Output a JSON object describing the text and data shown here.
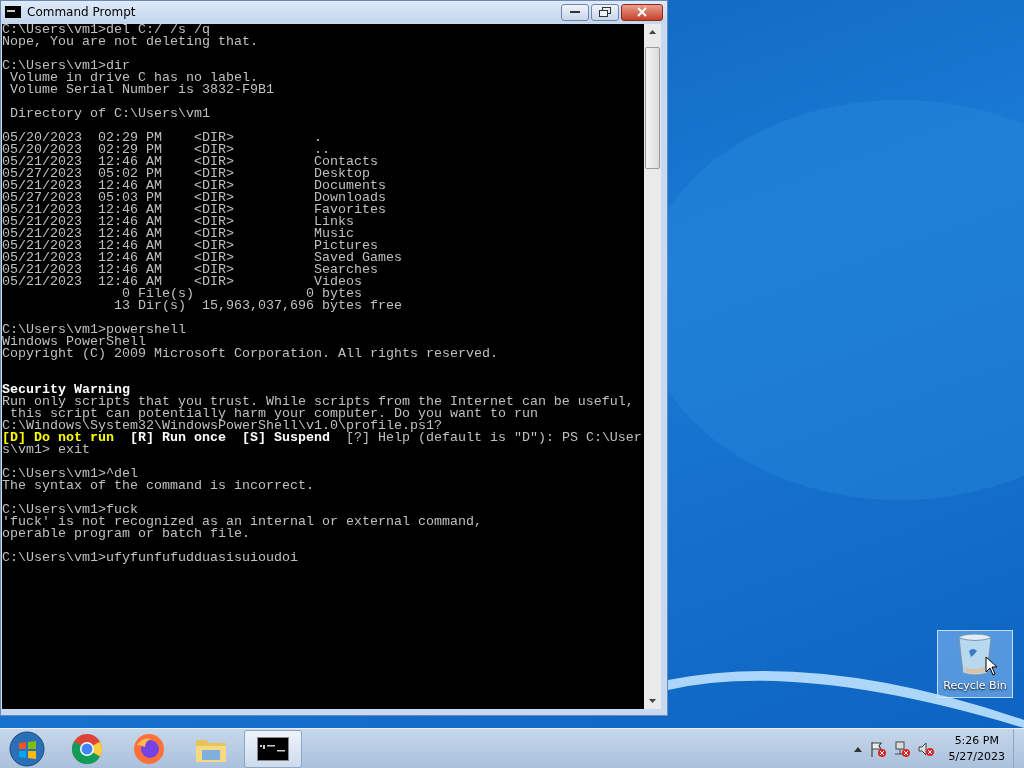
{
  "window": {
    "title": "Command Prompt",
    "console_lines": [
      {
        "kind": "output",
        "text": "C:\\Users\\vm1>del C:/ /s /q"
      },
      {
        "kind": "output",
        "text": "Nope, You are not deleting that."
      },
      {
        "kind": "blank"
      },
      {
        "kind": "output",
        "text": "C:\\Users\\vm1>dir"
      },
      {
        "kind": "output",
        "text": " Volume in drive C has no label."
      },
      {
        "kind": "output",
        "text": " Volume Serial Number is 3832-F9B1"
      },
      {
        "kind": "blank"
      },
      {
        "kind": "output",
        "text": " Directory of C:\\Users\\vm1"
      },
      {
        "kind": "blank"
      },
      {
        "kind": "output",
        "text": "05/20/2023  02:29 PM    <DIR>          ."
      },
      {
        "kind": "output",
        "text": "05/20/2023  02:29 PM    <DIR>          .."
      },
      {
        "kind": "output",
        "text": "05/21/2023  12:46 AM    <DIR>          Contacts"
      },
      {
        "kind": "output",
        "text": "05/27/2023  05:02 PM    <DIR>          Desktop"
      },
      {
        "kind": "output",
        "text": "05/21/2023  12:46 AM    <DIR>          Documents"
      },
      {
        "kind": "output",
        "text": "05/27/2023  05:03 PM    <DIR>          Downloads"
      },
      {
        "kind": "output",
        "text": "05/21/2023  12:46 AM    <DIR>          Favorites"
      },
      {
        "kind": "output",
        "text": "05/21/2023  12:46 AM    <DIR>          Links"
      },
      {
        "kind": "output",
        "text": "05/21/2023  12:46 AM    <DIR>          Music"
      },
      {
        "kind": "output",
        "text": "05/21/2023  12:46 AM    <DIR>          Pictures"
      },
      {
        "kind": "output",
        "text": "05/21/2023  12:46 AM    <DIR>          Saved Games"
      },
      {
        "kind": "output",
        "text": "05/21/2023  12:46 AM    <DIR>          Searches"
      },
      {
        "kind": "output",
        "text": "05/21/2023  12:46 AM    <DIR>          Videos"
      },
      {
        "kind": "output",
        "text": "               0 File(s)              0 bytes"
      },
      {
        "kind": "output",
        "text": "              13 Dir(s)  15,963,037,696 bytes free"
      },
      {
        "kind": "blank"
      },
      {
        "kind": "output",
        "text": "C:\\Users\\vm1>powershell"
      },
      {
        "kind": "output",
        "text": "Windows PowerShell"
      },
      {
        "kind": "output",
        "text": "Copyright (C) 2009 Microsoft Corporation. All rights reserved."
      },
      {
        "kind": "blank"
      },
      {
        "kind": "blank"
      },
      {
        "kind": "heading",
        "text": "Security Warning"
      },
      {
        "kind": "output",
        "text": "Run only scripts that you trust. While scripts from the Internet can be useful,"
      },
      {
        "kind": "output",
        "text": " this script can potentially harm your computer. Do you want to run"
      },
      {
        "kind": "output",
        "text": "C:\\Windows\\System32\\WindowsPowerShell\\v1.0\\profile.ps1?"
      },
      {
        "kind": "prompt",
        "parts": [
          {
            "kind": "default_choice",
            "text": "[D] Do not run"
          },
          {
            "kind": "choice",
            "text": "  [R] Run once  [S] Suspend"
          },
          {
            "kind": "output",
            "text": "  [?] Help (default is \"D\"): PS C:\\User"
          }
        ]
      },
      {
        "kind": "output",
        "text": "s\\vm1> exit"
      },
      {
        "kind": "blank"
      },
      {
        "kind": "output",
        "text": "C:\\Users\\vm1>^del"
      },
      {
        "kind": "output",
        "text": "The syntax of the command is incorrect."
      },
      {
        "kind": "blank"
      },
      {
        "kind": "output",
        "text": "C:\\Users\\vm1>fuck"
      },
      {
        "kind": "output",
        "text": "'fuck' is not recognized as an internal or external command,"
      },
      {
        "kind": "output",
        "text": "operable program or batch file."
      },
      {
        "kind": "blank"
      },
      {
        "kind": "output",
        "text": "C:\\Users\\vm1>ufyfunfufudduasisuioudoi"
      }
    ]
  },
  "desktop_icons": [
    {
      "label": "Recycle Bin",
      "selected": true
    }
  ],
  "taskbar": {
    "apps": [
      {
        "kind": "chrome",
        "selected": false
      },
      {
        "kind": "firefox",
        "selected": false
      },
      {
        "kind": "explorer",
        "selected": false
      },
      {
        "kind": "console",
        "selected": true
      }
    ],
    "clock": {
      "time": "5:26 PM",
      "date": "5/27/2023"
    }
  }
}
